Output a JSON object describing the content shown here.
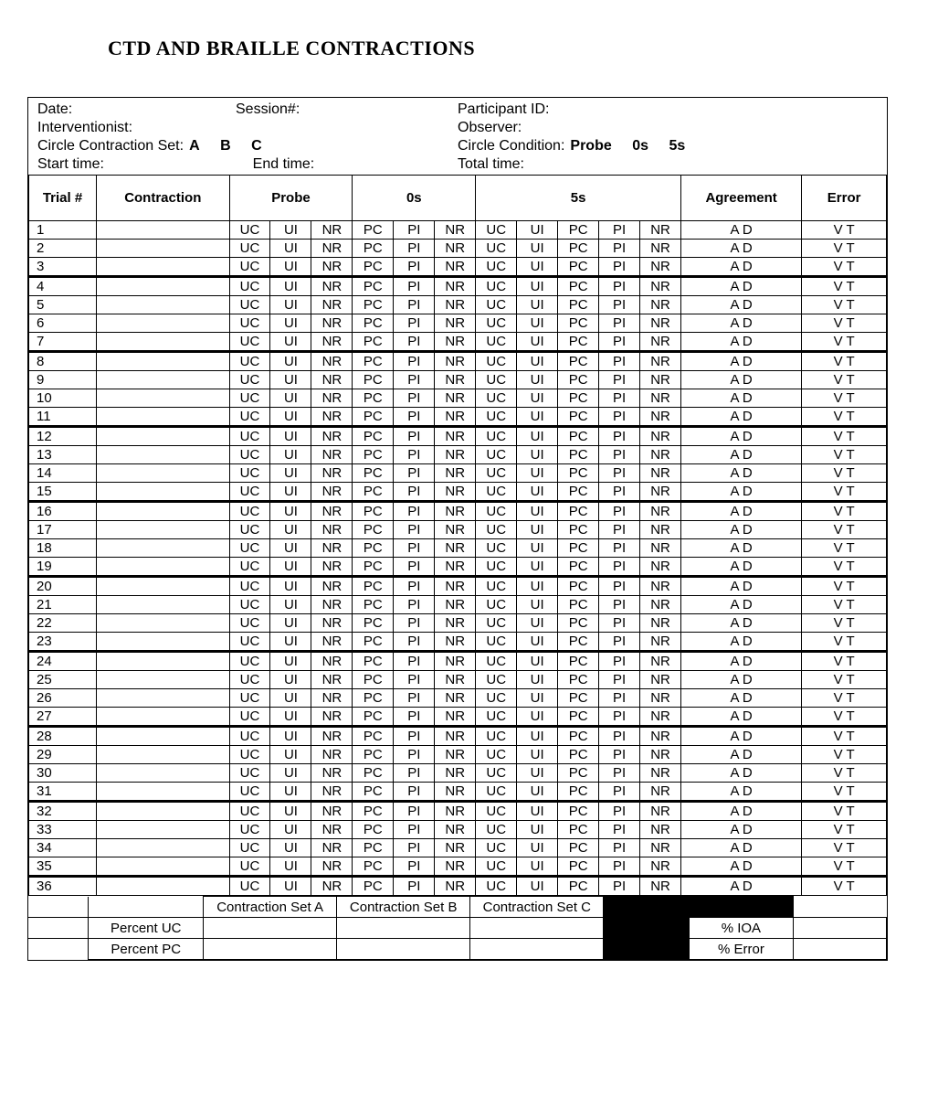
{
  "title": "CTD AND BRAILLE CONTRACTIONS",
  "meta": {
    "date_label": "Date:",
    "session_label": "Session#:",
    "participant_label": "Participant ID:",
    "interventionist_label": "Interventionist:",
    "observer_label": "Observer:",
    "circle_set_label": "Circle Contraction Set:",
    "set_options": [
      "A",
      "B",
      "C"
    ],
    "circle_condition_label": "Circle Condition:",
    "condition_options": [
      "Probe",
      "0s",
      "5s"
    ],
    "start_label": "Start time:",
    "end_label": "End time:",
    "total_label": "Total time:"
  },
  "columns": {
    "trial": "Trial #",
    "contraction": "Contraction",
    "probe": "Probe",
    "zero": "0s",
    "five": "5s",
    "agreement": "Agreement",
    "error": "Error"
  },
  "codes": {
    "probe": [
      "UC",
      "UI",
      "NR"
    ],
    "zero": [
      "PC",
      "PI",
      "NR"
    ],
    "five": [
      "UC",
      "UI",
      "PC",
      "PI",
      "NR"
    ],
    "agreement": [
      "A",
      "D"
    ],
    "error": [
      "V",
      "T"
    ]
  },
  "trial_count": 36,
  "group_starts": [
    4,
    8,
    12,
    16,
    20,
    24,
    28,
    32,
    36
  ],
  "summary": {
    "contraction_a": "Contraction Set A",
    "contraction_b": "Contraction Set B",
    "contraction_c": "Contraction Set C",
    "percent_uc": "Percent UC",
    "percent_pc": "Percent PC",
    "pct_ioa": "% IOA",
    "pct_error": "% Error"
  }
}
